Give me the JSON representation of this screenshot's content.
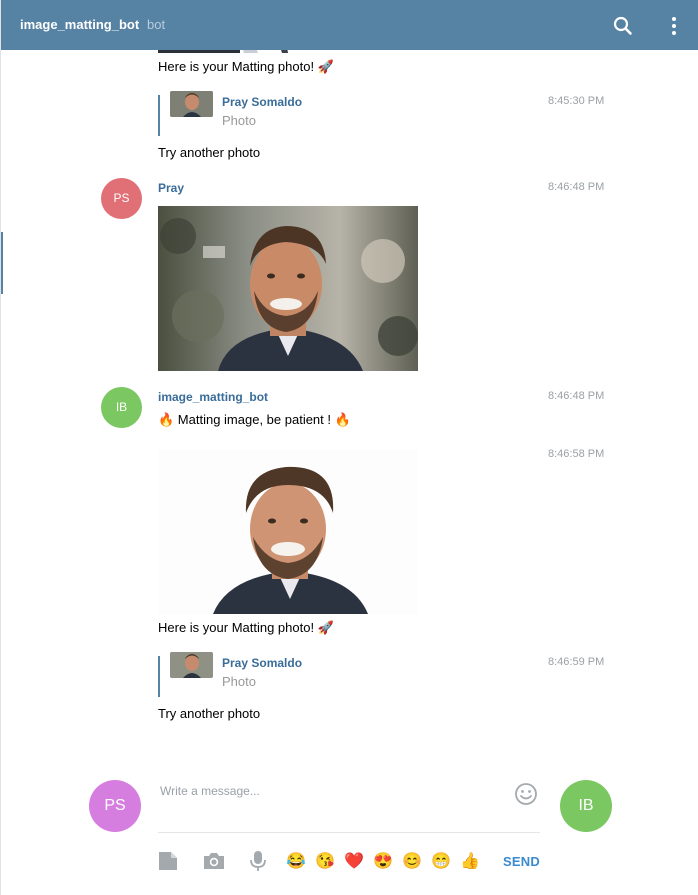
{
  "header": {
    "title": "image_matting_bot",
    "subtitle": "bot"
  },
  "messages": {
    "m1": {
      "text": "Here is your Matting photo! 🚀"
    },
    "m2": {
      "reply_name": "Pray Somaldo",
      "reply_sub": "Photo",
      "time": "8:45:30 PM",
      "text": "Try another photo"
    },
    "m3": {
      "avatar": "PS",
      "author": "Pray",
      "time": "8:46:48 PM"
    },
    "m4": {
      "avatar": "IB",
      "author": "image_matting_bot",
      "time": "8:46:48 PM",
      "text": "🔥 Matting image, be patient ! 🔥"
    },
    "m5": {
      "time": "8:46:58 PM",
      "text": "Here is your Matting photo! 🚀"
    },
    "m6": {
      "reply_name": "Pray Somaldo",
      "reply_sub": "Photo",
      "time": "8:46:59 PM",
      "text": "Try another photo"
    }
  },
  "composer": {
    "left_avatar": "PS",
    "right_avatar": "IB",
    "placeholder": "Write a message...",
    "send_label": "SEND",
    "emojis": [
      "😂",
      "😘",
      "❤️",
      "😍",
      "😊",
      "😁",
      "👍"
    ]
  },
  "colors": {
    "header": "#5682a3",
    "link": "#3a6d99",
    "avatar_ps": "#e17076",
    "avatar_ib": "#7bc862",
    "avatar_ps_composer": "#d67ee0",
    "send": "#3a8ad0"
  },
  "icons": {
    "search": "search-icon",
    "more": "more-vertical-icon",
    "emoji": "smiley-icon",
    "file": "document-icon",
    "camera": "camera-icon",
    "mic": "microphone-icon"
  }
}
